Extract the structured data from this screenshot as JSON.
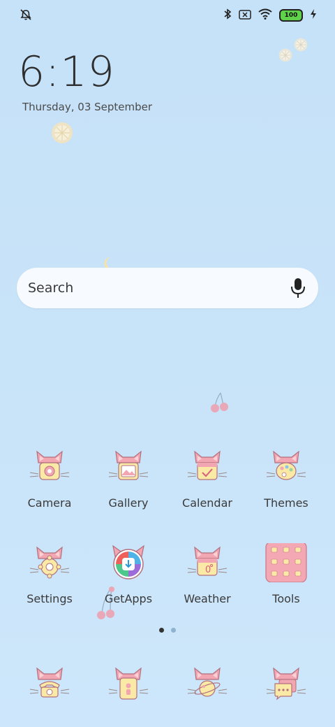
{
  "status_bar": {
    "left_icon": "alarm-off-icon",
    "right_icons": [
      "bluetooth-icon",
      "sim-x-icon",
      "wifi-icon"
    ],
    "battery_level": "100",
    "charging_icon": "bolt-icon"
  },
  "clock": {
    "time": "6:19",
    "date": "Thursday, 03 September"
  },
  "search": {
    "placeholder": "Search",
    "mic_icon": "mic-icon"
  },
  "apps_row1": [
    {
      "label": "Camera",
      "icon": "camera-icon"
    },
    {
      "label": "Gallery",
      "icon": "gallery-icon"
    },
    {
      "label": "Calendar",
      "icon": "calendar-icon"
    },
    {
      "label": "Themes",
      "icon": "palette-icon"
    }
  ],
  "apps_row2": [
    {
      "label": "Settings",
      "icon": "gear-icon"
    },
    {
      "label": "GetApps",
      "icon": "getapps-icon"
    },
    {
      "label": "Weather",
      "icon": "weather-icon"
    },
    {
      "label": "Tools",
      "icon": "tools-folder-icon"
    }
  ],
  "dock": [
    {
      "icon": "phone-icon"
    },
    {
      "icon": "contacts-icon"
    },
    {
      "icon": "browser-icon"
    },
    {
      "icon": "messages-icon"
    }
  ],
  "page_indicator": {
    "pages": 2,
    "current": 1
  },
  "colors": {
    "background": "#c6e2f8",
    "cat_pink": "#f2a6b2",
    "cat_yellow": "#fbe9a6",
    "battery_green": "#5fd14a",
    "dot_active": "#333333",
    "dot_inactive": "#8fb3cf"
  }
}
